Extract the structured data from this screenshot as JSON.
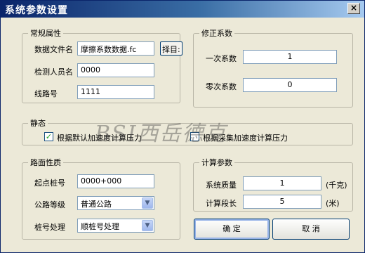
{
  "window": {
    "title": "系统参数设置",
    "close_label": "×"
  },
  "general": {
    "legend": "常规属性",
    "data_file_label": "数据文件名",
    "data_file_value": "摩擦系数数据.fc",
    "browse_label": "择目:",
    "inspector_label": "检测人员名",
    "inspector_value": "0000",
    "line_label": "线路号",
    "line_value": "1111"
  },
  "correction": {
    "legend": "修正系数",
    "primary_label": "一次系数",
    "primary_value": "1",
    "zero_label": "零次系数",
    "zero_value": "0"
  },
  "static": {
    "legend": "静态",
    "option_default_label": "根据默认加速度计算压力",
    "option_default_checked": "✓",
    "option_collect_label": "根据采集加速度计算压力"
  },
  "road": {
    "legend": "路面性质",
    "start_pile_label": "起点桩号",
    "start_pile_value": "0000+000",
    "grade_label": "公路等级",
    "grade_value": "普通公路",
    "pile_proc_label": "桩号处理",
    "pile_proc_value": "顺桩号处理"
  },
  "calc": {
    "legend": "计算参数",
    "mass_label": "系统质量",
    "mass_value": "1",
    "mass_unit": "(千克)",
    "length_label": "计算段长",
    "length_value": "5",
    "length_unit": "(米)"
  },
  "buttons": {
    "ok": "确 定",
    "cancel": "取 消"
  },
  "watermark": "BSI西岳德克"
}
